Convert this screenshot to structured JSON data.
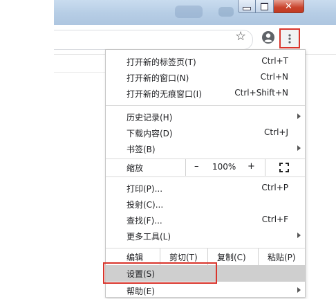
{
  "window_controls": {
    "minimize_icon": "minimize-icon",
    "maximize_icon": "maximize-icon",
    "close_icon": "close-icon"
  },
  "toolbar": {
    "bookmark_icon": "star-icon",
    "profile_icon": "account-circle-icon",
    "menu_icon": "vertical-dots-icon"
  },
  "menu": {
    "new_tab": {
      "label": "打开新的标签页(T)",
      "shortcut": "Ctrl+T"
    },
    "new_window": {
      "label": "打开新的窗口(N)",
      "shortcut": "Ctrl+N"
    },
    "incognito": {
      "label": "打开新的无痕窗口(I)",
      "shortcut": "Ctrl+Shift+N"
    },
    "history": {
      "label": "历史记录(H)"
    },
    "downloads": {
      "label": "下载内容(D)",
      "shortcut": "Ctrl+J"
    },
    "bookmarks": {
      "label": "书签(B)"
    },
    "zoom": {
      "label": "缩放",
      "minus": "–",
      "value": "100%",
      "plus": "+",
      "fullscreen_icon": "fullscreen-icon"
    },
    "print": {
      "label": "打印(P)...",
      "shortcut": "Ctrl+P"
    },
    "cast": {
      "label": "投射(C)..."
    },
    "find": {
      "label": "查找(F)...",
      "shortcut": "Ctrl+F"
    },
    "more_tools": {
      "label": "更多工具(L)"
    },
    "edit": {
      "label": "编辑",
      "cut": "剪切(T)",
      "copy": "复制(C)",
      "paste": "粘贴(P)"
    },
    "settings": {
      "label": "设置(S)"
    },
    "help": {
      "label": "帮助(E)"
    }
  },
  "colors": {
    "highlight_border": "#d9342b",
    "selected_row": "#cfcfcf",
    "titlebar": "#b6cde5"
  }
}
